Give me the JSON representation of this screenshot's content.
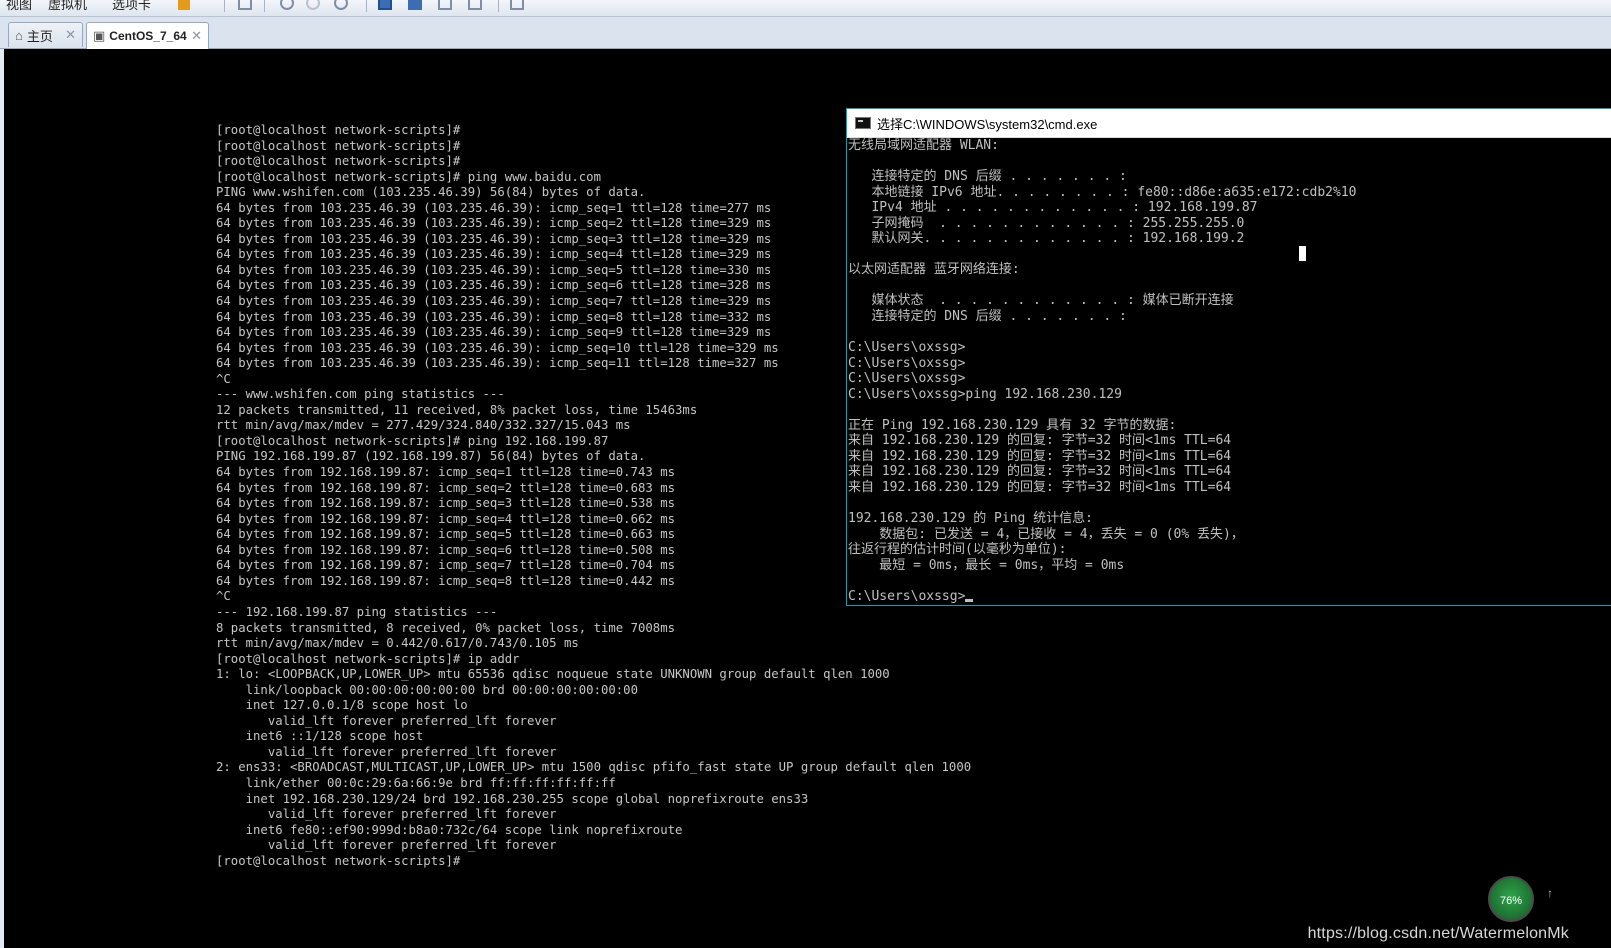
{
  "toolbar": {
    "menu_view": "视图",
    "menu_vm": "虚拟机",
    "menu_tabs": "选项卡"
  },
  "tabs": [
    {
      "label": "主页",
      "icon": "home-icon"
    },
    {
      "label": "CentOS_7_64",
      "icon": "vm-icon"
    }
  ],
  "linux_terminal": {
    "lines": [
      "[root@localhost network-scripts]#",
      "[root@localhost network-scripts]#",
      "[root@localhost network-scripts]#",
      "[root@localhost network-scripts]# ping www.baidu.com",
      "PING www.wshifen.com (103.235.46.39) 56(84) bytes of data.",
      "64 bytes from 103.235.46.39 (103.235.46.39): icmp_seq=1 ttl=128 time=277 ms",
      "64 bytes from 103.235.46.39 (103.235.46.39): icmp_seq=2 ttl=128 time=329 ms",
      "64 bytes from 103.235.46.39 (103.235.46.39): icmp_seq=3 ttl=128 time=329 ms",
      "64 bytes from 103.235.46.39 (103.235.46.39): icmp_seq=4 ttl=128 time=329 ms",
      "64 bytes from 103.235.46.39 (103.235.46.39): icmp_seq=5 ttl=128 time=330 ms",
      "64 bytes from 103.235.46.39 (103.235.46.39): icmp_seq=6 ttl=128 time=328 ms",
      "64 bytes from 103.235.46.39 (103.235.46.39): icmp_seq=7 ttl=128 time=329 ms",
      "64 bytes from 103.235.46.39 (103.235.46.39): icmp_seq=8 ttl=128 time=332 ms",
      "64 bytes from 103.235.46.39 (103.235.46.39): icmp_seq=9 ttl=128 time=329 ms",
      "64 bytes from 103.235.46.39 (103.235.46.39): icmp_seq=10 ttl=128 time=329 ms",
      "64 bytes from 103.235.46.39 (103.235.46.39): icmp_seq=11 ttl=128 time=327 ms",
      "^C",
      "--- www.wshifen.com ping statistics ---",
      "12 packets transmitted, 11 received, 8% packet loss, time 15463ms",
      "rtt min/avg/max/mdev = 277.429/324.840/332.327/15.043 ms",
      "[root@localhost network-scripts]# ping 192.168.199.87",
      "PING 192.168.199.87 (192.168.199.87) 56(84) bytes of data.",
      "64 bytes from 192.168.199.87: icmp_seq=1 ttl=128 time=0.743 ms",
      "64 bytes from 192.168.199.87: icmp_seq=2 ttl=128 time=0.683 ms",
      "64 bytes from 192.168.199.87: icmp_seq=3 ttl=128 time=0.538 ms",
      "64 bytes from 192.168.199.87: icmp_seq=4 ttl=128 time=0.662 ms",
      "64 bytes from 192.168.199.87: icmp_seq=5 ttl=128 time=0.663 ms",
      "64 bytes from 192.168.199.87: icmp_seq=6 ttl=128 time=0.508 ms",
      "64 bytes from 192.168.199.87: icmp_seq=7 ttl=128 time=0.704 ms",
      "64 bytes from 192.168.199.87: icmp_seq=8 ttl=128 time=0.442 ms",
      "^C",
      "--- 192.168.199.87 ping statistics ---",
      "8 packets transmitted, 8 received, 0% packet loss, time 7008ms",
      "rtt min/avg/max/mdev = 0.442/0.617/0.743/0.105 ms",
      "[root@localhost network-scripts]# ip addr",
      "1: lo: <LOOPBACK,UP,LOWER_UP> mtu 65536 qdisc noqueue state UNKNOWN group default qlen 1000",
      "    link/loopback 00:00:00:00:00:00 brd 00:00:00:00:00:00",
      "    inet 127.0.0.1/8 scope host lo",
      "       valid_lft forever preferred_lft forever",
      "    inet6 ::1/128 scope host",
      "       valid_lft forever preferred_lft forever",
      "2: ens33: <BROADCAST,MULTICAST,UP,LOWER_UP> mtu 1500 qdisc pfifo_fast state UP group default qlen 1000",
      "    link/ether 00:0c:29:6a:66:9e brd ff:ff:ff:ff:ff:ff",
      "    inet 192.168.230.129/24 brd 192.168.230.255 scope global noprefixroute ens33",
      "       valid_lft forever preferred_lft forever",
      "    inet6 fe80::ef90:999d:b8a0:732c/64 scope link noprefixroute",
      "       valid_lft forever preferred_lft forever",
      "[root@localhost network-scripts]#"
    ]
  },
  "cmd_window": {
    "title": "选择C:\\WINDOWS\\system32\\cmd.exe",
    "lines": [
      "无线局域网适配器 WLAN:",
      "",
      "   连接特定的 DNS 后缀 . . . . . . . :",
      "   本地链接 IPv6 地址. . . . . . . . : fe80::d86e:a635:e172:cdb2%10",
      "   IPv4 地址 . . . . . . . . . . . . : 192.168.199.87",
      "   子网掩码  . . . . . . . . . . . . : 255.255.255.0",
      "   默认网关. . . . . . . . . . . . . : 192.168.199.2",
      "",
      "以太网适配器 蓝牙网络连接:",
      "",
      "   媒体状态  . . . . . . . . . . . . : 媒体已断开连接",
      "   连接特定的 DNS 后缀 . . . . . . . :",
      "",
      "C:\\Users\\oxssg>",
      "C:\\Users\\oxssg>",
      "C:\\Users\\oxssg>",
      "C:\\Users\\oxssg>ping 192.168.230.129",
      "",
      "正在 Ping 192.168.230.129 具有 32 字节的数据:",
      "来自 192.168.230.129 的回复: 字节=32 时间<1ms TTL=64",
      "来自 192.168.230.129 的回复: 字节=32 时间<1ms TTL=64",
      "来自 192.168.230.129 的回复: 字节=32 时间<1ms TTL=64",
      "来自 192.168.230.129 的回复: 字节=32 时间<1ms TTL=64",
      "",
      "192.168.230.129 的 Ping 统计信息:",
      "    数据包: 已发送 = 4，已接收 = 4，丢失 = 0 (0% 丢失)，",
      "往返行程的估计时间(以毫秒为单位):",
      "    最短 = 0ms，最长 = 0ms，平均 = 0ms",
      ""
    ],
    "prompt": "C:\\Users\\oxssg>"
  },
  "overlay": {
    "watermark": "https://blog.csdn.net/WatermelonMk",
    "gauge_value": "76%"
  },
  "colors": {
    "terminal_fg": "#c6c6c6",
    "terminal_bg": "#000000",
    "cmd_border": "#2a93a5"
  }
}
